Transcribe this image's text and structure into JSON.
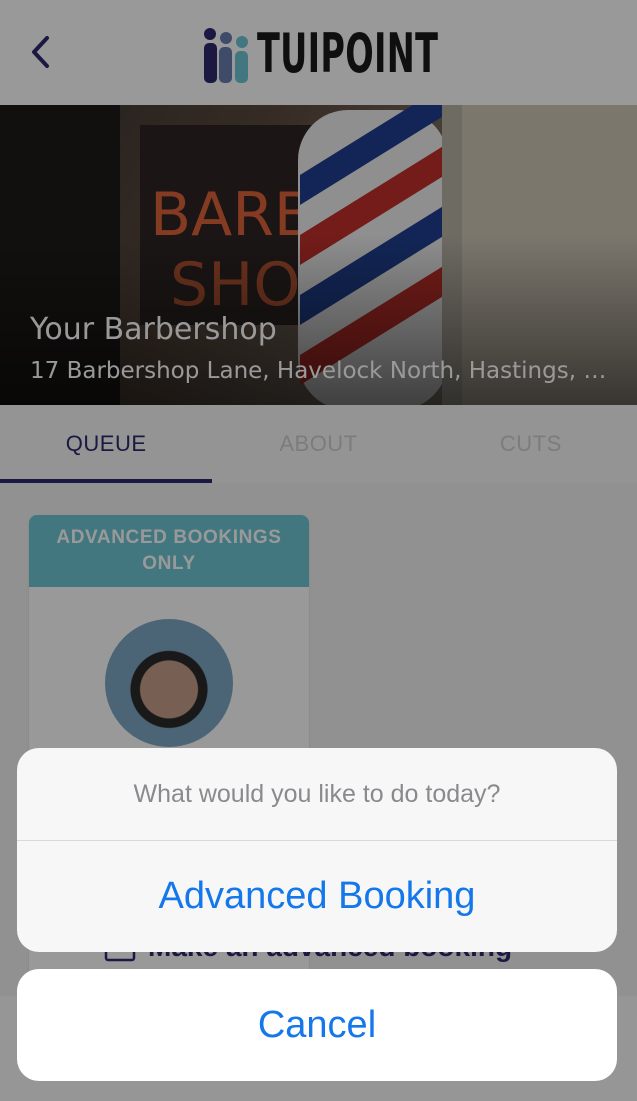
{
  "header": {
    "brand": "TUIPOINT"
  },
  "shop": {
    "name": "Your Barbershop",
    "address": "17 Barbershop Lane, Havelock North, Hastings, Ha..."
  },
  "tabs": [
    {
      "label": "QUEUE",
      "active": true
    },
    {
      "label": "ABOUT",
      "active": false
    },
    {
      "label": "CUTS",
      "active": false
    }
  ],
  "card": {
    "banner": "ADVANCED BOOKINGS ONLY",
    "booking_link": "Make an advanced booking"
  },
  "action_sheet": {
    "title": "What would you like to do today?",
    "action": "Advanced Booking",
    "cancel": "Cancel"
  },
  "colors": {
    "accent": "#2e2a6e",
    "ios_blue": "#1477ea",
    "banner": "#6ec7d6"
  }
}
